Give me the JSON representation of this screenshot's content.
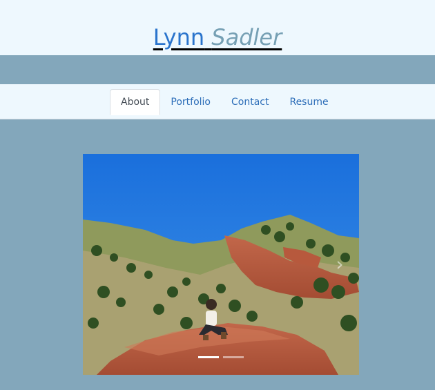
{
  "site": {
    "first_name": "Lynn",
    "last_name": "Sadler"
  },
  "nav": {
    "tabs": [
      {
        "label": "About",
        "active": true
      },
      {
        "label": "Portfolio",
        "active": false
      },
      {
        "label": "Contact",
        "active": false
      },
      {
        "label": "Resume",
        "active": false
      }
    ]
  },
  "carousel": {
    "image_description": "woman sitting on red rocks under blue sky",
    "slide_count": 2,
    "active_slide": 1,
    "next_icon": "chevron-right-icon"
  },
  "colors": {
    "page_bg": "#83a7bb",
    "header_bg": "#eef8fe",
    "link": "#2a74cc",
    "accent_italic": "#76a0b4",
    "sky": "#1f79e0"
  }
}
